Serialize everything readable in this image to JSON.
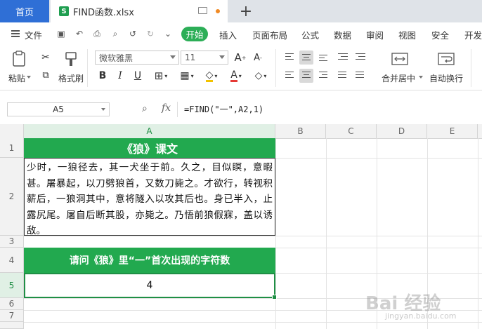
{
  "tabs": {
    "home": "首页",
    "file": "FIND函数.xlsx"
  },
  "menu": {
    "file": "文件",
    "items": [
      "开始",
      "插入",
      "页面布局",
      "公式",
      "数据",
      "审阅",
      "视图",
      "安全",
      "开发"
    ]
  },
  "ribbon": {
    "paste": "粘贴",
    "format_painter": "格式刷",
    "font_name": "微软雅黑",
    "font_size": "11",
    "merge_center": "合并居中",
    "wrap_text": "自动换行"
  },
  "formula_bar": {
    "cell_ref": "A5",
    "fx": "fx",
    "formula": "=FIND(\"一\",A2,1)"
  },
  "columns": [
    "A",
    "B",
    "C",
    "D",
    "E"
  ],
  "rows": [
    "1",
    "2",
    "3",
    "4",
    "5",
    "6",
    "7"
  ],
  "cells": {
    "A1": "《狼》课文",
    "A2": "少时，一狼径去，其一犬坐于前。久之，目似瞑，意暇甚。屠暴起，以刀劈狼首，又数刀毙之。才欲行，转视积薪后，一狼洞其中，意将隧入以攻其后也。身已半入，止露尻尾。屠自后断其股，亦毙之。乃悟前狼假寐，盖以诱敌。",
    "A4": "请问《狼》里“一”首次出现的字符数",
    "A5": "4"
  },
  "watermark": {
    "brand": "Bai 经验",
    "url": "jingyan.baidu.com"
  },
  "colors": {
    "accent_green": "#22a94f",
    "tab_blue": "#2f6fd6"
  }
}
